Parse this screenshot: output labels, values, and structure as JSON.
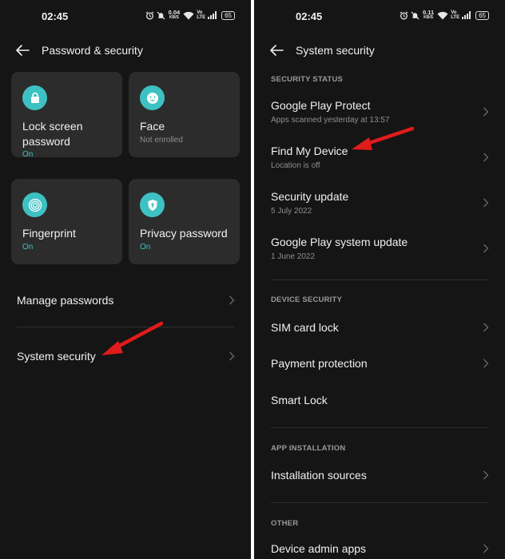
{
  "status_bar": {
    "time": "02:45",
    "left_speed": "0.04",
    "right_speed": "0.11",
    "speed_unit": "KB/S",
    "volte_top": "Vo",
    "volte_bottom": "LTE",
    "battery": "65"
  },
  "left_screen": {
    "title": "Password & security",
    "tiles": [
      {
        "label": "Lock screen password",
        "status": "On",
        "icon": "lock-icon"
      },
      {
        "label": "Face",
        "status": "Not enrolled",
        "icon": "face-icon"
      },
      {
        "label": "Fingerprint",
        "status": "On",
        "icon": "fingerprint-icon"
      },
      {
        "label": "Privacy password",
        "status": "On",
        "icon": "privacy-shield-icon"
      }
    ],
    "items": [
      {
        "label": "Manage passwords"
      },
      {
        "label": "System security"
      }
    ]
  },
  "right_screen": {
    "title": "System security",
    "sections": [
      {
        "header": "SECURITY STATUS",
        "items": [
          {
            "title": "Google Play Protect",
            "subtitle": "Apps scanned yesterday at 13:57"
          },
          {
            "title": "Find My Device",
            "subtitle": "Location is off"
          },
          {
            "title": "Security update",
            "subtitle": "5 July 2022"
          },
          {
            "title": "Google Play system update",
            "subtitle": "1 June 2022"
          }
        ]
      },
      {
        "header": "DEVICE SECURITY",
        "items": [
          {
            "title": "SIM card lock"
          },
          {
            "title": "Payment protection"
          },
          {
            "title": "Smart Lock"
          }
        ]
      },
      {
        "header": "APP INSTALLATION",
        "items": [
          {
            "title": "Installation sources"
          }
        ]
      },
      {
        "header": "OTHER",
        "items": [
          {
            "title": "Device admin apps"
          }
        ]
      }
    ]
  },
  "colors": {
    "background": "#151515",
    "tile": "#2c2c2c",
    "accent": "#3ec1c3",
    "annotation_arrow": "#e01b1b"
  }
}
